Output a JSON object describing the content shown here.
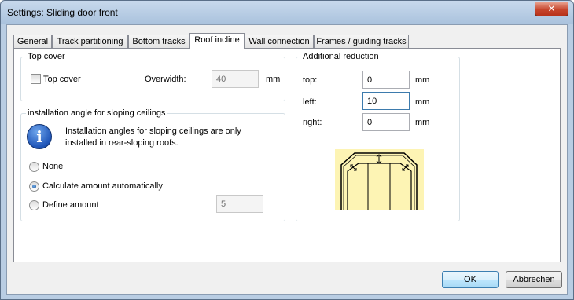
{
  "window": {
    "title": "Settings: Sliding door front",
    "close_glyph": "✕"
  },
  "tabs": [
    {
      "label": "General"
    },
    {
      "label": "Track partitioning"
    },
    {
      "label": "Bottom tracks"
    },
    {
      "label": "Roof incline",
      "active": true
    },
    {
      "label": "Wall connection"
    },
    {
      "label": "Frames / guiding tracks"
    }
  ],
  "top_cover": {
    "group_title": "Top cover",
    "checkbox_label": "Top cover",
    "checked": false,
    "overwidth_label": "Overwidth:",
    "overwidth_value": "40",
    "overwidth_unit": "mm"
  },
  "installation_angle": {
    "group_title": "installation angle for sloping ceilings",
    "info_text_line1": "Installation angles for sloping ceilings are only",
    "info_text_line2": "installed in rear-sloping roofs.",
    "info_icon_glyph": "i",
    "options": [
      {
        "label": "None",
        "selected": false
      },
      {
        "label": "Calculate amount automatically",
        "selected": true
      },
      {
        "label": "Define amount",
        "selected": false
      }
    ],
    "define_amount_value": "5"
  },
  "additional_reduction": {
    "group_title": "Additional reduction",
    "top_label": "top:",
    "top_value": "0",
    "left_label": "left:",
    "left_value": "10",
    "right_label": "right:",
    "right_value": "0",
    "unit": "mm"
  },
  "footer": {
    "ok_label": "OK",
    "cancel_label": "Abbrechen"
  },
  "colors": {
    "diagram_background": "#fdf4b4",
    "close_button": "#c6452c",
    "window_frame": "#b9cde3"
  }
}
